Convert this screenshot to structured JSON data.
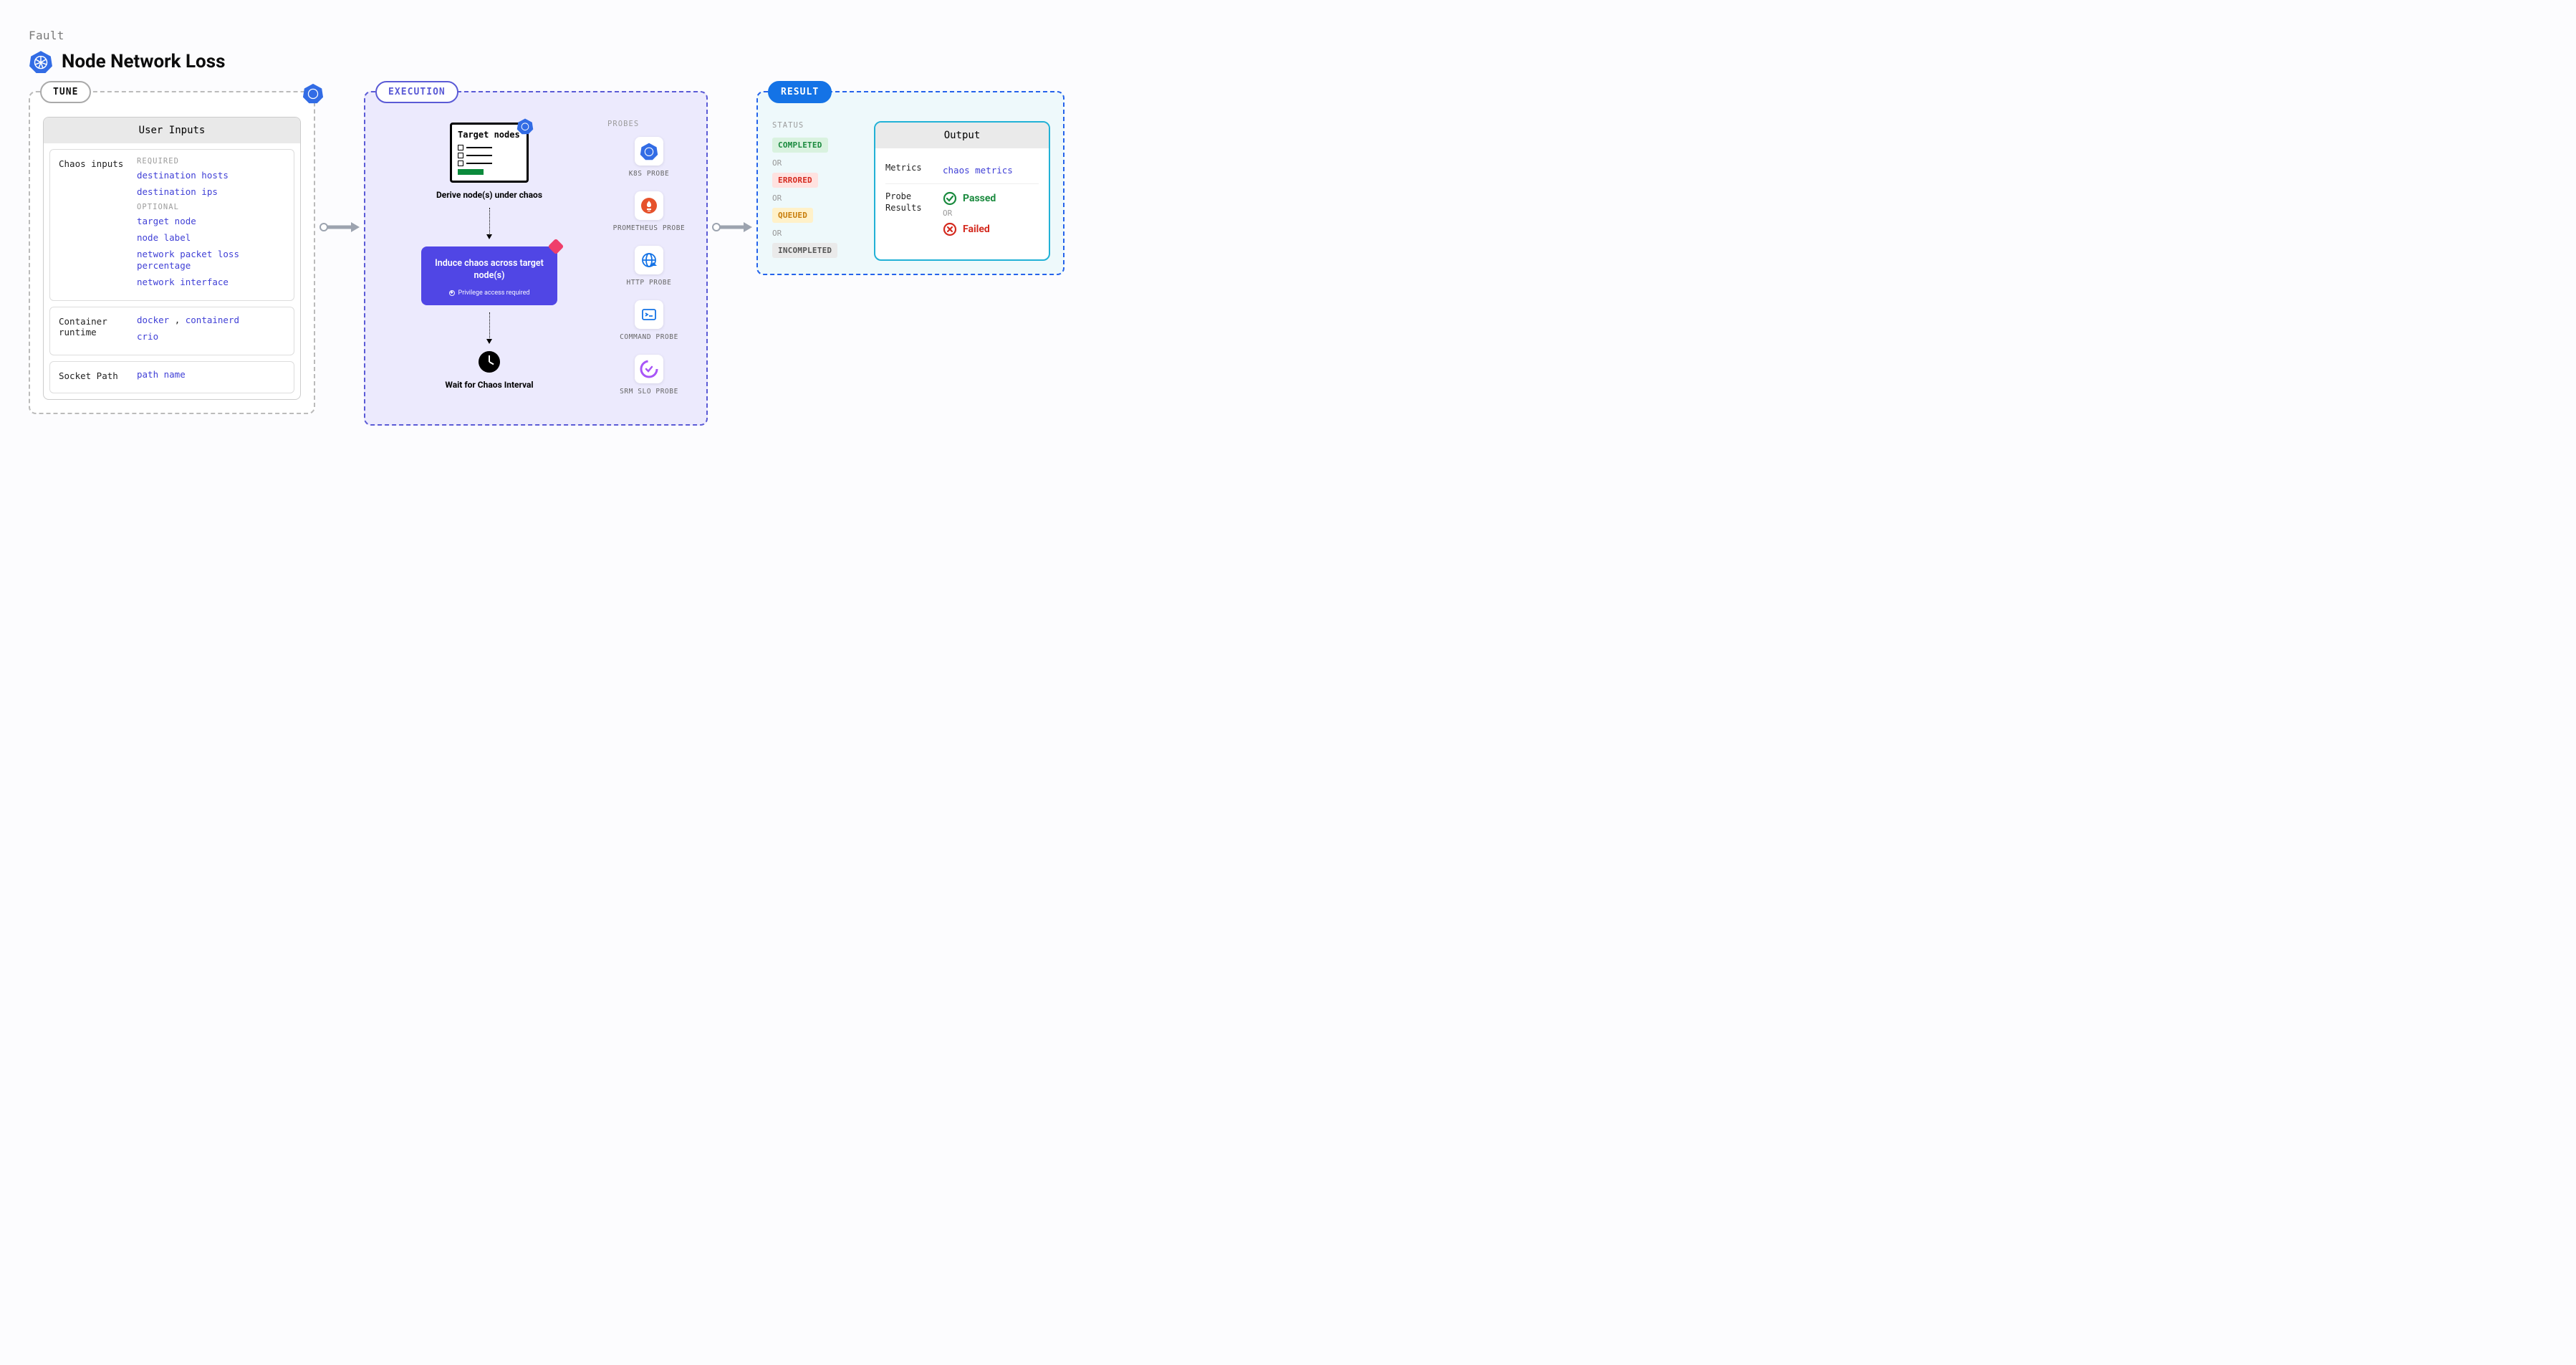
{
  "header": {
    "category": "Fault",
    "title": "Node Network Loss"
  },
  "tune": {
    "pill": "TUNE",
    "card_title": "User Inputs",
    "sections": [
      {
        "label": "Chaos inputs",
        "groups": [
          {
            "label": "REQUIRED",
            "values": [
              "destination hosts",
              "destination ips"
            ]
          },
          {
            "label": "OPTIONAL",
            "values": [
              "target node",
              "node label",
              "network packet loss percentage",
              "network interface"
            ]
          }
        ]
      },
      {
        "label": "Container runtime",
        "groups": [
          {
            "label": "",
            "values_inline": [
              "docker",
              "containerd"
            ],
            "values": [
              "crio"
            ]
          }
        ]
      },
      {
        "label": "Socket Path",
        "groups": [
          {
            "label": "",
            "values": [
              "path name"
            ]
          }
        ]
      }
    ]
  },
  "execution": {
    "pill": "EXECUTION",
    "target_card_title": "Target nodes",
    "step1": "Derive node(s) under chaos",
    "induce_title": "Induce chaos across target node(s)",
    "induce_note": "Privilege access required",
    "step3": "Wait for Chaos Interval",
    "probes_label": "PROBES",
    "probes": [
      {
        "name": "K8S PROBE",
        "icon": "k8s"
      },
      {
        "name": "PROMETHEUS PROBE",
        "icon": "prometheus"
      },
      {
        "name": "HTTP PROBE",
        "icon": "http"
      },
      {
        "name": "COMMAND PROBE",
        "icon": "command"
      },
      {
        "name": "SRM SLO PROBE",
        "icon": "srm"
      }
    ]
  },
  "result": {
    "pill": "RESULT",
    "status_label": "STATUS",
    "or": "OR",
    "statuses": [
      "COMPLETED",
      "ERRORED",
      "QUEUED",
      "INCOMPLETED"
    ],
    "output_title": "Output",
    "metrics_label": "Metrics",
    "metrics_value": "chaos metrics",
    "probe_results_label": "Probe Results",
    "passed": "Passed",
    "failed": "Failed"
  }
}
